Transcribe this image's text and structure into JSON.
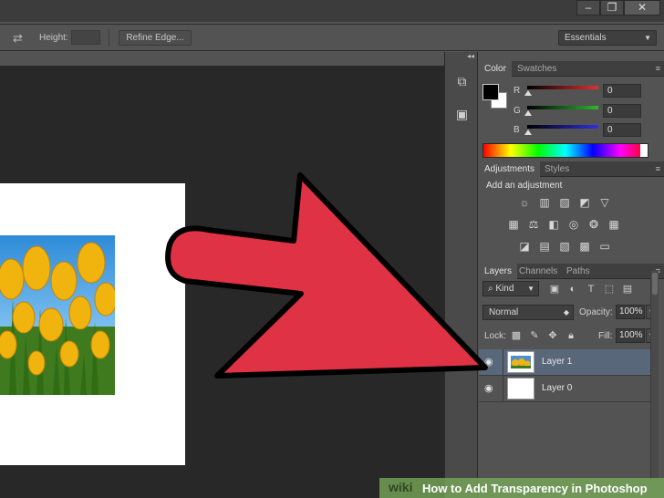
{
  "window": {
    "buttons": [
      "–",
      "❐",
      "✕"
    ]
  },
  "options_bar": {
    "height_label": "Height:",
    "refine_edge_label": "Refine Edge...",
    "workspace_selected": "Essentials"
  },
  "color_panel": {
    "tabs": [
      "Color",
      "Swatches"
    ],
    "channels": [
      {
        "label": "R",
        "value": "0",
        "color": "#e03030"
      },
      {
        "label": "G",
        "value": "0",
        "color": "#2fb62f"
      },
      {
        "label": "B",
        "value": "0",
        "color": "#2f2fe6"
      }
    ],
    "foreground": "#000000",
    "background": "#ffffff"
  },
  "adjustments_panel": {
    "tabs": [
      "Adjustments",
      "Styles"
    ],
    "title": "Add an adjustment"
  },
  "layers_panel": {
    "tabs": [
      "Layers",
      "Channels",
      "Paths"
    ],
    "kind_label": "Kind",
    "blend_mode": "Normal",
    "opacity_label": "Opacity:",
    "opacity_value": "100%",
    "lock_label": "Lock:",
    "fill_label": "Fill:",
    "fill_value": "100%",
    "layers": [
      {
        "name": "Layer 1",
        "selected": true
      },
      {
        "name": "Layer 0",
        "selected": false
      }
    ]
  },
  "watermark": {
    "brand": "wiki",
    "title": "How to Add Transparency in Photoshop"
  },
  "colors": {
    "arrow_fill": "#e03245",
    "selection": "#59677a"
  }
}
